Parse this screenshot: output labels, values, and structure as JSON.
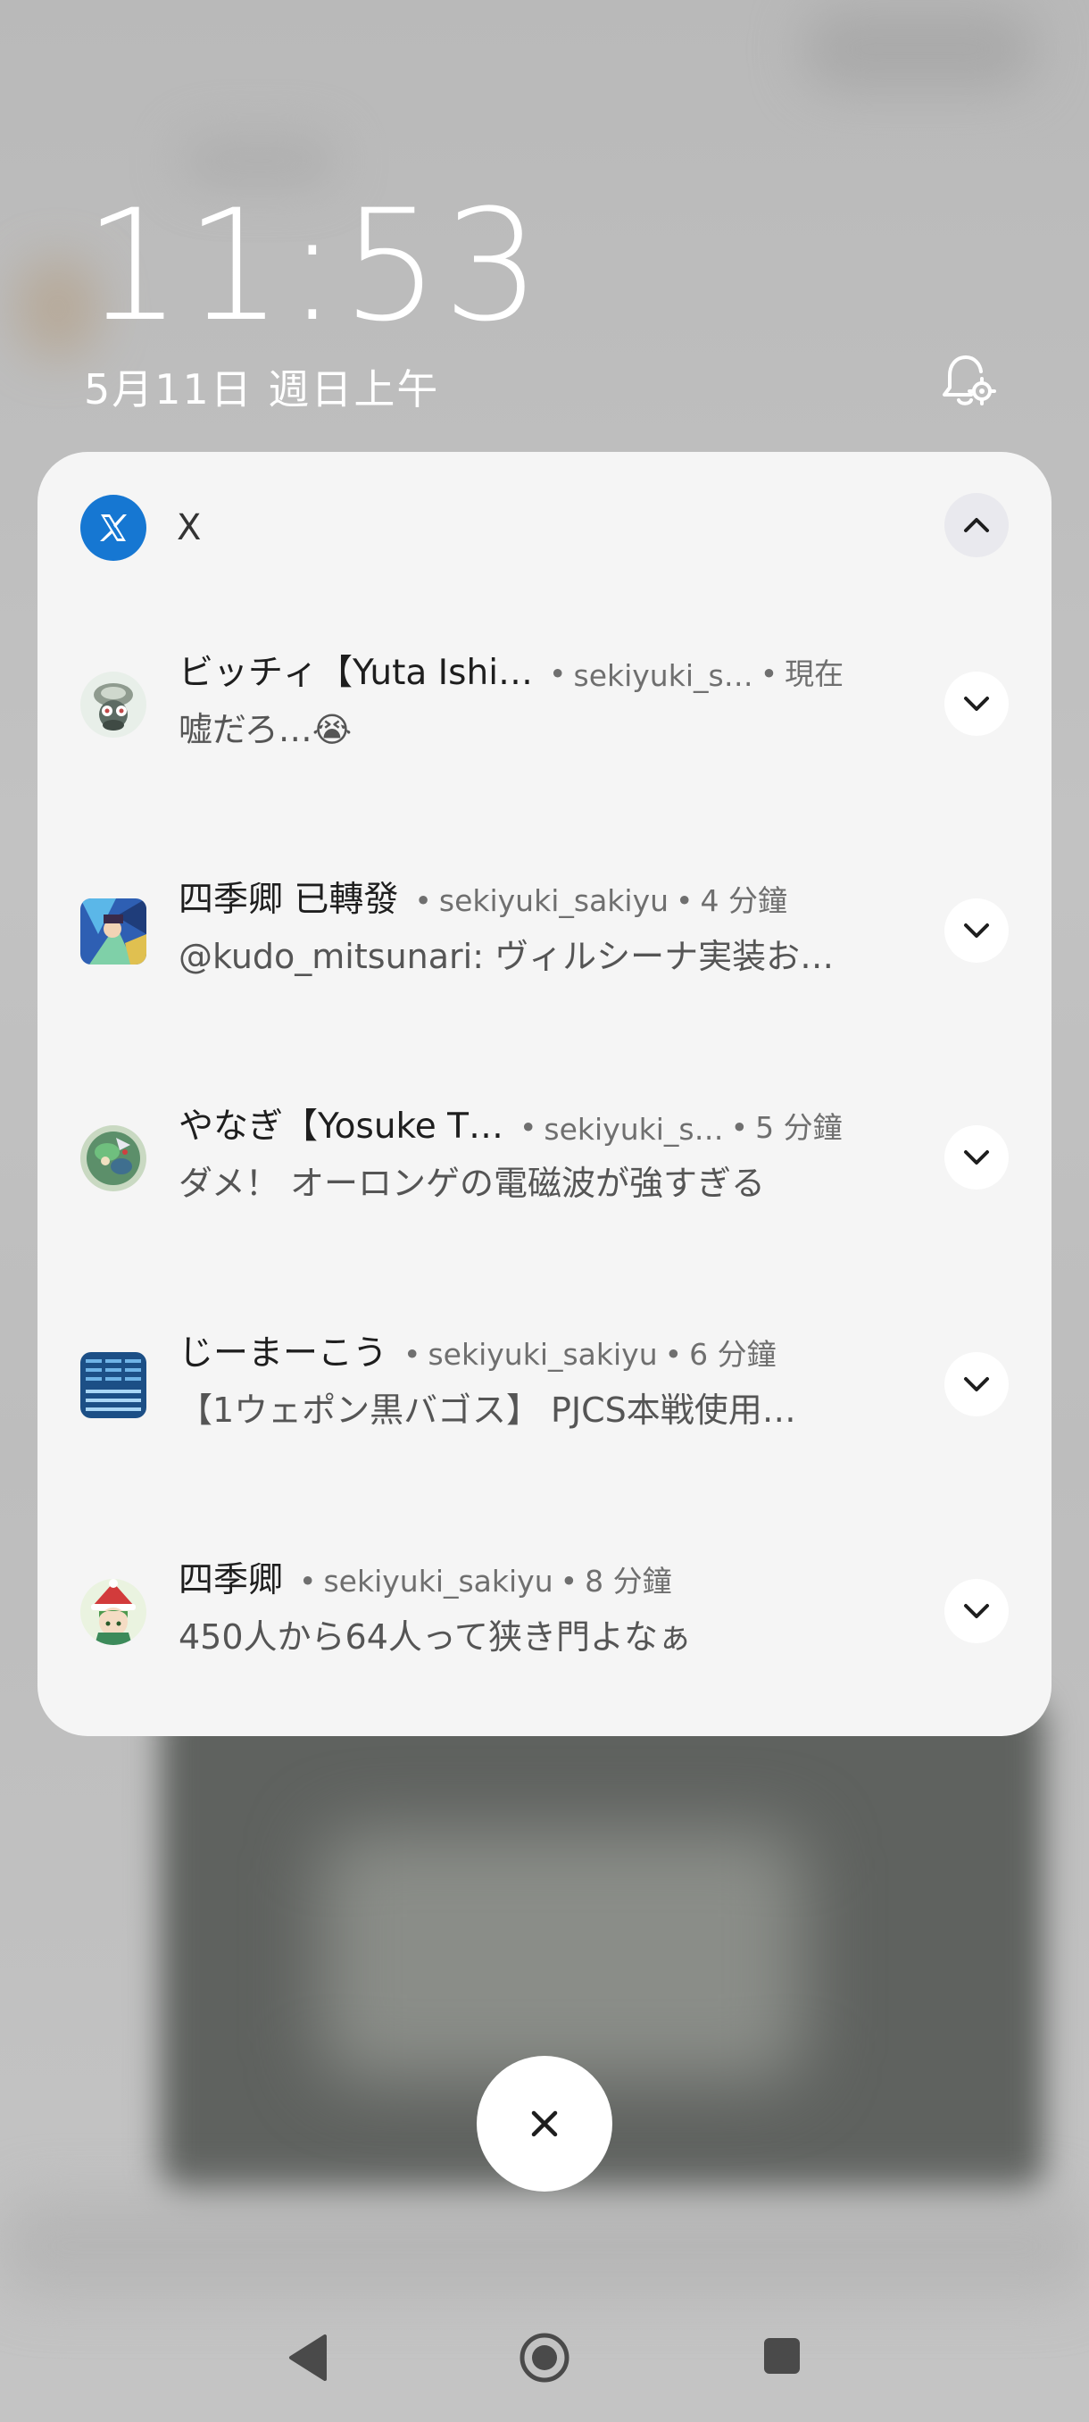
{
  "lockscreen": {
    "time": "11:53",
    "date": "5月11日 週日上午",
    "notification_settings_icon": "bell-gear-icon"
  },
  "notification_group": {
    "app_name": "X",
    "app_icon": "x-logo-icon",
    "accent_color": "#1677d2",
    "items": [
      {
        "sender": "ビッチィ【Yuta Ishi…",
        "handle": "sekiyuki_s…",
        "time": "現在",
        "message": "嘘だろ…😭"
      },
      {
        "sender": "四季卿 已轉發",
        "handle": "sekiyuki_sakiyu",
        "time": "4 分鐘",
        "message": "@kudo_mitsunari: ヴィルシーナ実装お…"
      },
      {
        "sender": "やなぎ【Yosuke T…",
        "handle": "sekiyuki_s…",
        "time": "5 分鐘",
        "message": "ダメ！ オーロンゲの電磁波が強すぎる"
      },
      {
        "sender": "じーまーこう",
        "handle": "sekiyuki_sakiyu",
        "time": "6 分鐘",
        "message": "【1ウェポン黒バゴス】 PJCS本戦使用…"
      },
      {
        "sender": "四季卿",
        "handle": "sekiyuki_sakiyu",
        "time": "8 分鐘",
        "message": "450人から64人って狭き門よなぁ"
      }
    ]
  },
  "dismiss_button_icon": "close-icon",
  "navigation": {
    "back": "back-triangle-icon",
    "home": "home-circle-icon",
    "recents": "recents-square-icon"
  }
}
